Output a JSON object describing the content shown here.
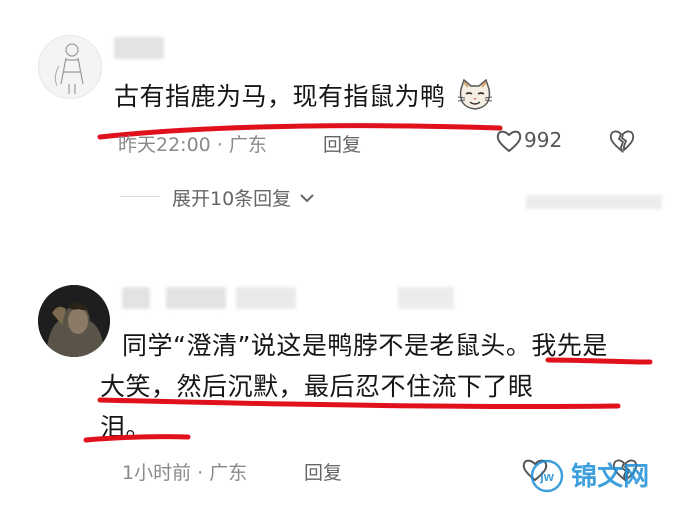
{
  "comments": [
    {
      "text": "古有指鹿为马，现有指鼠为鸭",
      "emoji_icon": "cat-face-icon",
      "time": "昨天22:00",
      "location": "广东",
      "reply_label": "回复",
      "like_count": "992",
      "expand_label": "展开10条回复"
    },
    {
      "text_lines": [
        "同学“澄清”说这是鸭脖不是老鼠头。我先是",
        "大笑，然后沉默，最后忍不住流下了眼",
        "泪。"
      ],
      "time": "1小时前",
      "location": "广东",
      "reply_label": "回复"
    }
  ],
  "watermark": {
    "text": "锦文网",
    "icon": "jw-logo-icon"
  },
  "colors": {
    "highlight_stroke": "#e0101c",
    "meta_text": "#8a8a8a",
    "watermark": "#1e8fd6"
  }
}
